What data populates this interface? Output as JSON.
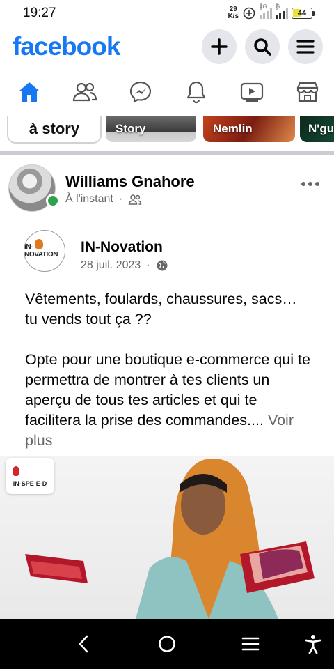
{
  "status_bar": {
    "time": "19:27",
    "net_speed_value": "29",
    "net_speed_unit": "K/s",
    "sim1_tag": "4G",
    "sim2_tag": "G",
    "battery_level": "44",
    "battery_color": "#e9e43a"
  },
  "header": {
    "logo": "facebook",
    "brand_color": "#1877f2",
    "actions": [
      "plus-icon",
      "search-icon",
      "menu-icon"
    ]
  },
  "nav_tabs": [
    {
      "name": "home",
      "icon": "home-icon",
      "active": true
    },
    {
      "name": "friends",
      "icon": "friends-icon",
      "active": false
    },
    {
      "name": "messenger",
      "icon": "messenger-icon",
      "active": false
    },
    {
      "name": "notifications",
      "icon": "bell-icon",
      "active": false
    },
    {
      "name": "video",
      "icon": "video-icon",
      "active": false
    },
    {
      "name": "marketplace",
      "icon": "shop-icon",
      "active": false
    }
  ],
  "stories": {
    "create_label": "à story",
    "cards": [
      {
        "label": "Story"
      },
      {
        "label": "Nemlin"
      },
      {
        "label": "N'gu"
      }
    ]
  },
  "post": {
    "author": "Williams Gnahore",
    "time": "À l'instant",
    "audience_icon": "friends-icon",
    "shared": {
      "page_name": "IN-Novation",
      "page_logo_text": "IN-NOVATION",
      "date": "28 juil. 2023",
      "audience_icon": "globe-icon",
      "text_p1": "Vêtements, foulards, chaussures, sacs… tu vends tout ça ??",
      "text_p2": "Opte pour une boutique e-commerce qui te permettra de montrer à tes clients un aperçu de tous tes articles et qui te facilitera la prise des commandes....",
      "see_more": "Voir plus"
    },
    "image": {
      "brand_badge": "IN-SPE-E-D"
    }
  },
  "system_nav": [
    "back-icon",
    "home-circle-icon",
    "recents-icon",
    "accessibility-icon"
  ]
}
